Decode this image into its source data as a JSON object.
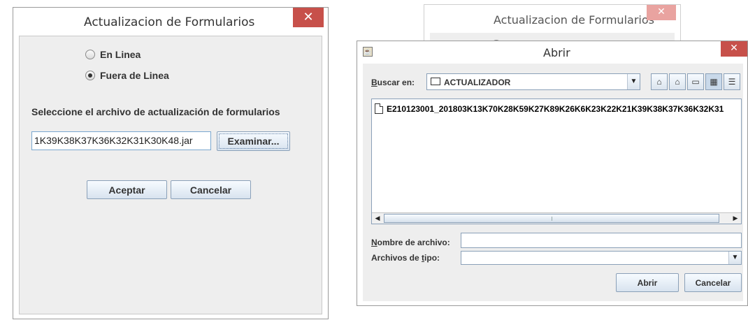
{
  "dialog_main": {
    "title": "Actualizacion de Formularios",
    "close_label": "✕",
    "radio_online": "En Linea",
    "radio_offline": "Fuera de Linea",
    "selected_radio": "Fuera de Linea",
    "instruction": "Seleccione el archivo de actualización de formularios",
    "file_value": "1K39K38K37K36K32K31K30K48.jar",
    "browse_label": "Examinar...",
    "accept_label": "Aceptar",
    "cancel_label": "Cancelar"
  },
  "background_dialog": {
    "title": "Actualizacion de Formularios",
    "close_label": "✕"
  },
  "open_dialog": {
    "title": "Abrir",
    "close_label": "✕",
    "look_in_label_u": "B",
    "look_in_label_rest": "uscar en:",
    "look_in_value": "ACTUALIZADOR",
    "toolbar_icons": [
      "up-folder-icon",
      "home-icon",
      "new-folder-icon",
      "list-view-icon",
      "details-view-icon"
    ],
    "file_items": [
      "E210123001_201803K13K70K28K59K27K89K26K6K23K22K21K39K38K37K36K32K31"
    ],
    "filename_label_u": "N",
    "filename_label_rest": "ombre de archivo:",
    "filename_value": "",
    "filetype_label_pre": "Archivos de ",
    "filetype_label_u": "t",
    "filetype_label_rest": "ipo:",
    "filetype_value": "",
    "open_label": "Abrir",
    "cancel_label": "Cancelar"
  }
}
